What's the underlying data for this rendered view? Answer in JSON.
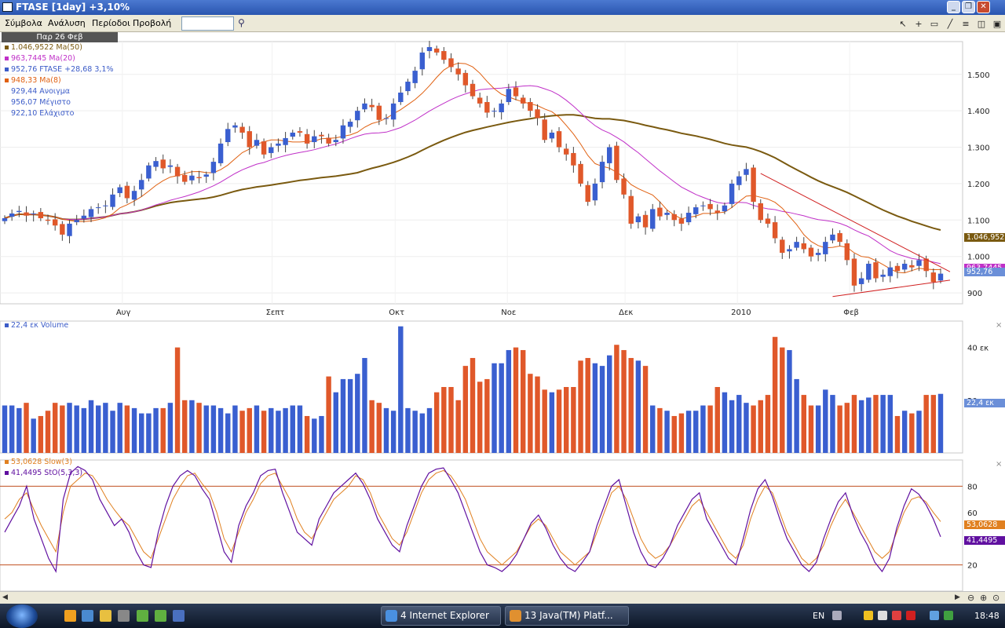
{
  "window": {
    "title": "FTASE [1day] +3,10%"
  },
  "menu": {
    "items": [
      "Σύμβολα",
      "Ανάλυση",
      "Περίοδοι",
      "Προβολή"
    ],
    "symbol_value": ""
  },
  "info": {
    "date": "Παρ 26 Φεβ"
  },
  "legend": [
    {
      "text": "1.046,9522 Ma(50)",
      "color": "#7a5a10"
    },
    {
      "text": "963,7445 Ma(20)",
      "color": "#c030c8"
    },
    {
      "text": "952,76 FTASE +28,68 3,1%",
      "color": "#3c5cc8"
    },
    {
      "text": "948,33 Ma(8)",
      "color": "#e06010"
    },
    {
      "text": "929,44 Ανοιγμα",
      "color": ""
    },
    {
      "text": "956,07 Μέγιστο",
      "color": ""
    },
    {
      "text": "922,10 Ελάχιστο",
      "color": ""
    }
  ],
  "price_axis": {
    "ticks": [
      "1.500",
      "1.400",
      "1.300",
      "1.200",
      "1.100",
      "1.000",
      "900"
    ]
  },
  "price_tags": {
    "ma50": "1.046,952",
    "ma20": "963,7445",
    "last": "952,76"
  },
  "time_axis": {
    "labels": [
      "Αυγ",
      "Σεπτ",
      "Οκτ",
      "Νοε",
      "Δεκ",
      "2010",
      "Φεβ"
    ]
  },
  "volume": {
    "legend": "22,4 εκ Volume",
    "ticks": [
      "40 εκ",
      "20 εκ"
    ],
    "tag": "22,4 εκ"
  },
  "stochastic": {
    "slow_legend": "53,0628 Slow(3)",
    "sto_legend": "41,4495 StO(5,3,3)",
    "ticks": [
      "80",
      "60",
      "20"
    ],
    "slow_tag": "53,0628",
    "sto_tag": "41,4495"
  },
  "taskbar": {
    "tasks": [
      "4 Internet Explorer",
      "13 Java(TM) Platf..."
    ],
    "lang": "EN",
    "clock": "18:48"
  },
  "colors": {
    "up": "#3a5fd0",
    "down": "#e0582a",
    "ma50": "#7a5a10",
    "ma20": "#c030c8",
    "ma8": "#e06010",
    "slow": "#e08020",
    "sto": "#6010a0"
  },
  "chart_data": {
    "type": "candlestick",
    "close": [
      1105,
      1118,
      1125,
      1112,
      1118,
      1105,
      1098,
      1085,
      1060,
      1090,
      1100,
      1112,
      1130,
      1135,
      1140,
      1170,
      1190,
      1160,
      1180,
      1210,
      1250,
      1262,
      1242,
      1250,
      1220,
      1205,
      1222,
      1215,
      1225,
      1260,
      1310,
      1350,
      1360,
      1340,
      1300,
      1320,
      1280,
      1300,
      1310,
      1325,
      1340,
      1340,
      1310,
      1330,
      1330,
      1310,
      1320,
      1360,
      1370,
      1400,
      1420,
      1410,
      1375,
      1380,
      1420,
      1450,
      1480,
      1510,
      1560,
      1575,
      1560,
      1540,
      1520,
      1500,
      1470,
      1440,
      1420,
      1395,
      1400,
      1420,
      1460,
      1440,
      1420,
      1400,
      1380,
      1320,
      1340,
      1300,
      1280,
      1250,
      1200,
      1150,
      1200,
      1260,
      1300,
      1210,
      1170,
      1090,
      1110,
      1080,
      1130,
      1110,
      1120,
      1100,
      1090,
      1120,
      1135,
      1140,
      1130,
      1120,
      1140,
      1200,
      1220,
      1240,
      1150,
      1100,
      1090,
      1050,
      1010,
      1020,
      1040,
      1020,
      1000,
      1010,
      1040,
      1060,
      1040,
      990,
      920,
      940,
      980,
      940,
      950,
      970,
      960,
      980,
      970,
      990,
      960,
      930,
      952.76
    ],
    "ma50_last": 1046.9522,
    "ma20_last": 963.7445,
    "ma8_last": 948.33,
    "last": {
      "open": 929.44,
      "high": 956.07,
      "low": 922.1,
      "close": 952.76
    },
    "volume": [
      18,
      18,
      17,
      19,
      13,
      14,
      16,
      19,
      18,
      19,
      18,
      17,
      20,
      18,
      19,
      16,
      19,
      18,
      17,
      15,
      15,
      17,
      17,
      19,
      40,
      20,
      20,
      19,
      18,
      18,
      17,
      15,
      18,
      16,
      17,
      18,
      16,
      17,
      16,
      17,
      18,
      18,
      14,
      13,
      14,
      29,
      23,
      28,
      28,
      30,
      36,
      20,
      19,
      17,
      16,
      48,
      17,
      16,
      15,
      17,
      23,
      25,
      25,
      20,
      33,
      36,
      27,
      28,
      34,
      34,
      39,
      40,
      39,
      30,
      29,
      24,
      23,
      24,
      25,
      25,
      35,
      36,
      34,
      33,
      37,
      41,
      39,
      36,
      35,
      33,
      18,
      17,
      16,
      14,
      15,
      16,
      16,
      18,
      18,
      25,
      23,
      20,
      22,
      19,
      18,
      20,
      22,
      44,
      40,
      39,
      28,
      22,
      18,
      18,
      24,
      22,
      18,
      19,
      22,
      20,
      21,
      22,
      22,
      22,
      14,
      16,
      15,
      16,
      22,
      22,
      22.4
    ],
    "volume_ylim": [
      0,
      50
    ],
    "price_ylim": [
      870,
      1590
    ],
    "stoch_slow": [
      55,
      60,
      70,
      75,
      62,
      50,
      40,
      30,
      60,
      80,
      85,
      90,
      88,
      80,
      70,
      62,
      55,
      50,
      40,
      30,
      25,
      40,
      55,
      70,
      80,
      88,
      90,
      82,
      75,
      60,
      40,
      30,
      45,
      60,
      70,
      82,
      88,
      90,
      80,
      70,
      55,
      45,
      40,
      50,
      60,
      70,
      75,
      80,
      88,
      85,
      75,
      60,
      50,
      40,
      35,
      45,
      60,
      75,
      85,
      90,
      92,
      88,
      80,
      70,
      55,
      40,
      30,
      25,
      20,
      25,
      30,
      40,
      50,
      55,
      50,
      40,
      30,
      25,
      20,
      25,
      30,
      45,
      60,
      75,
      80,
      70,
      55,
      40,
      30,
      25,
      28,
      35,
      45,
      55,
      65,
      70,
      60,
      50,
      40,
      30,
      25,
      35,
      55,
      70,
      80,
      75,
      60,
      45,
      35,
      25,
      20,
      25,
      35,
      50,
      62,
      70,
      60,
      50,
      40,
      30,
      25,
      30,
      45,
      60,
      70,
      72,
      68,
      60,
      53.06
    ],
    "stoch_k": [
      45,
      55,
      65,
      80,
      55,
      40,
      25,
      15,
      70,
      90,
      95,
      92,
      85,
      70,
      60,
      50,
      55,
      45,
      30,
      20,
      18,
      45,
      65,
      80,
      88,
      92,
      88,
      78,
      70,
      50,
      30,
      22,
      50,
      65,
      75,
      88,
      92,
      93,
      75,
      60,
      45,
      40,
      35,
      55,
      65,
      75,
      80,
      85,
      90,
      82,
      70,
      55,
      45,
      35,
      30,
      50,
      65,
      80,
      90,
      93,
      94,
      85,
      75,
      60,
      45,
      30,
      20,
      18,
      15,
      20,
      28,
      40,
      52,
      58,
      48,
      35,
      25,
      18,
      15,
      22,
      30,
      50,
      65,
      80,
      85,
      65,
      45,
      30,
      20,
      18,
      25,
      35,
      50,
      60,
      70,
      75,
      55,
      45,
      35,
      25,
      20,
      40,
      62,
      78,
      85,
      72,
      55,
      40,
      30,
      20,
      15,
      22,
      40,
      55,
      68,
      75,
      58,
      45,
      35,
      22,
      15,
      25,
      48,
      65,
      78,
      74,
      66,
      55,
      41.45
    ],
    "stoch_levels": [
      80,
      20
    ],
    "stoch_ylim": [
      0,
      100
    ]
  }
}
